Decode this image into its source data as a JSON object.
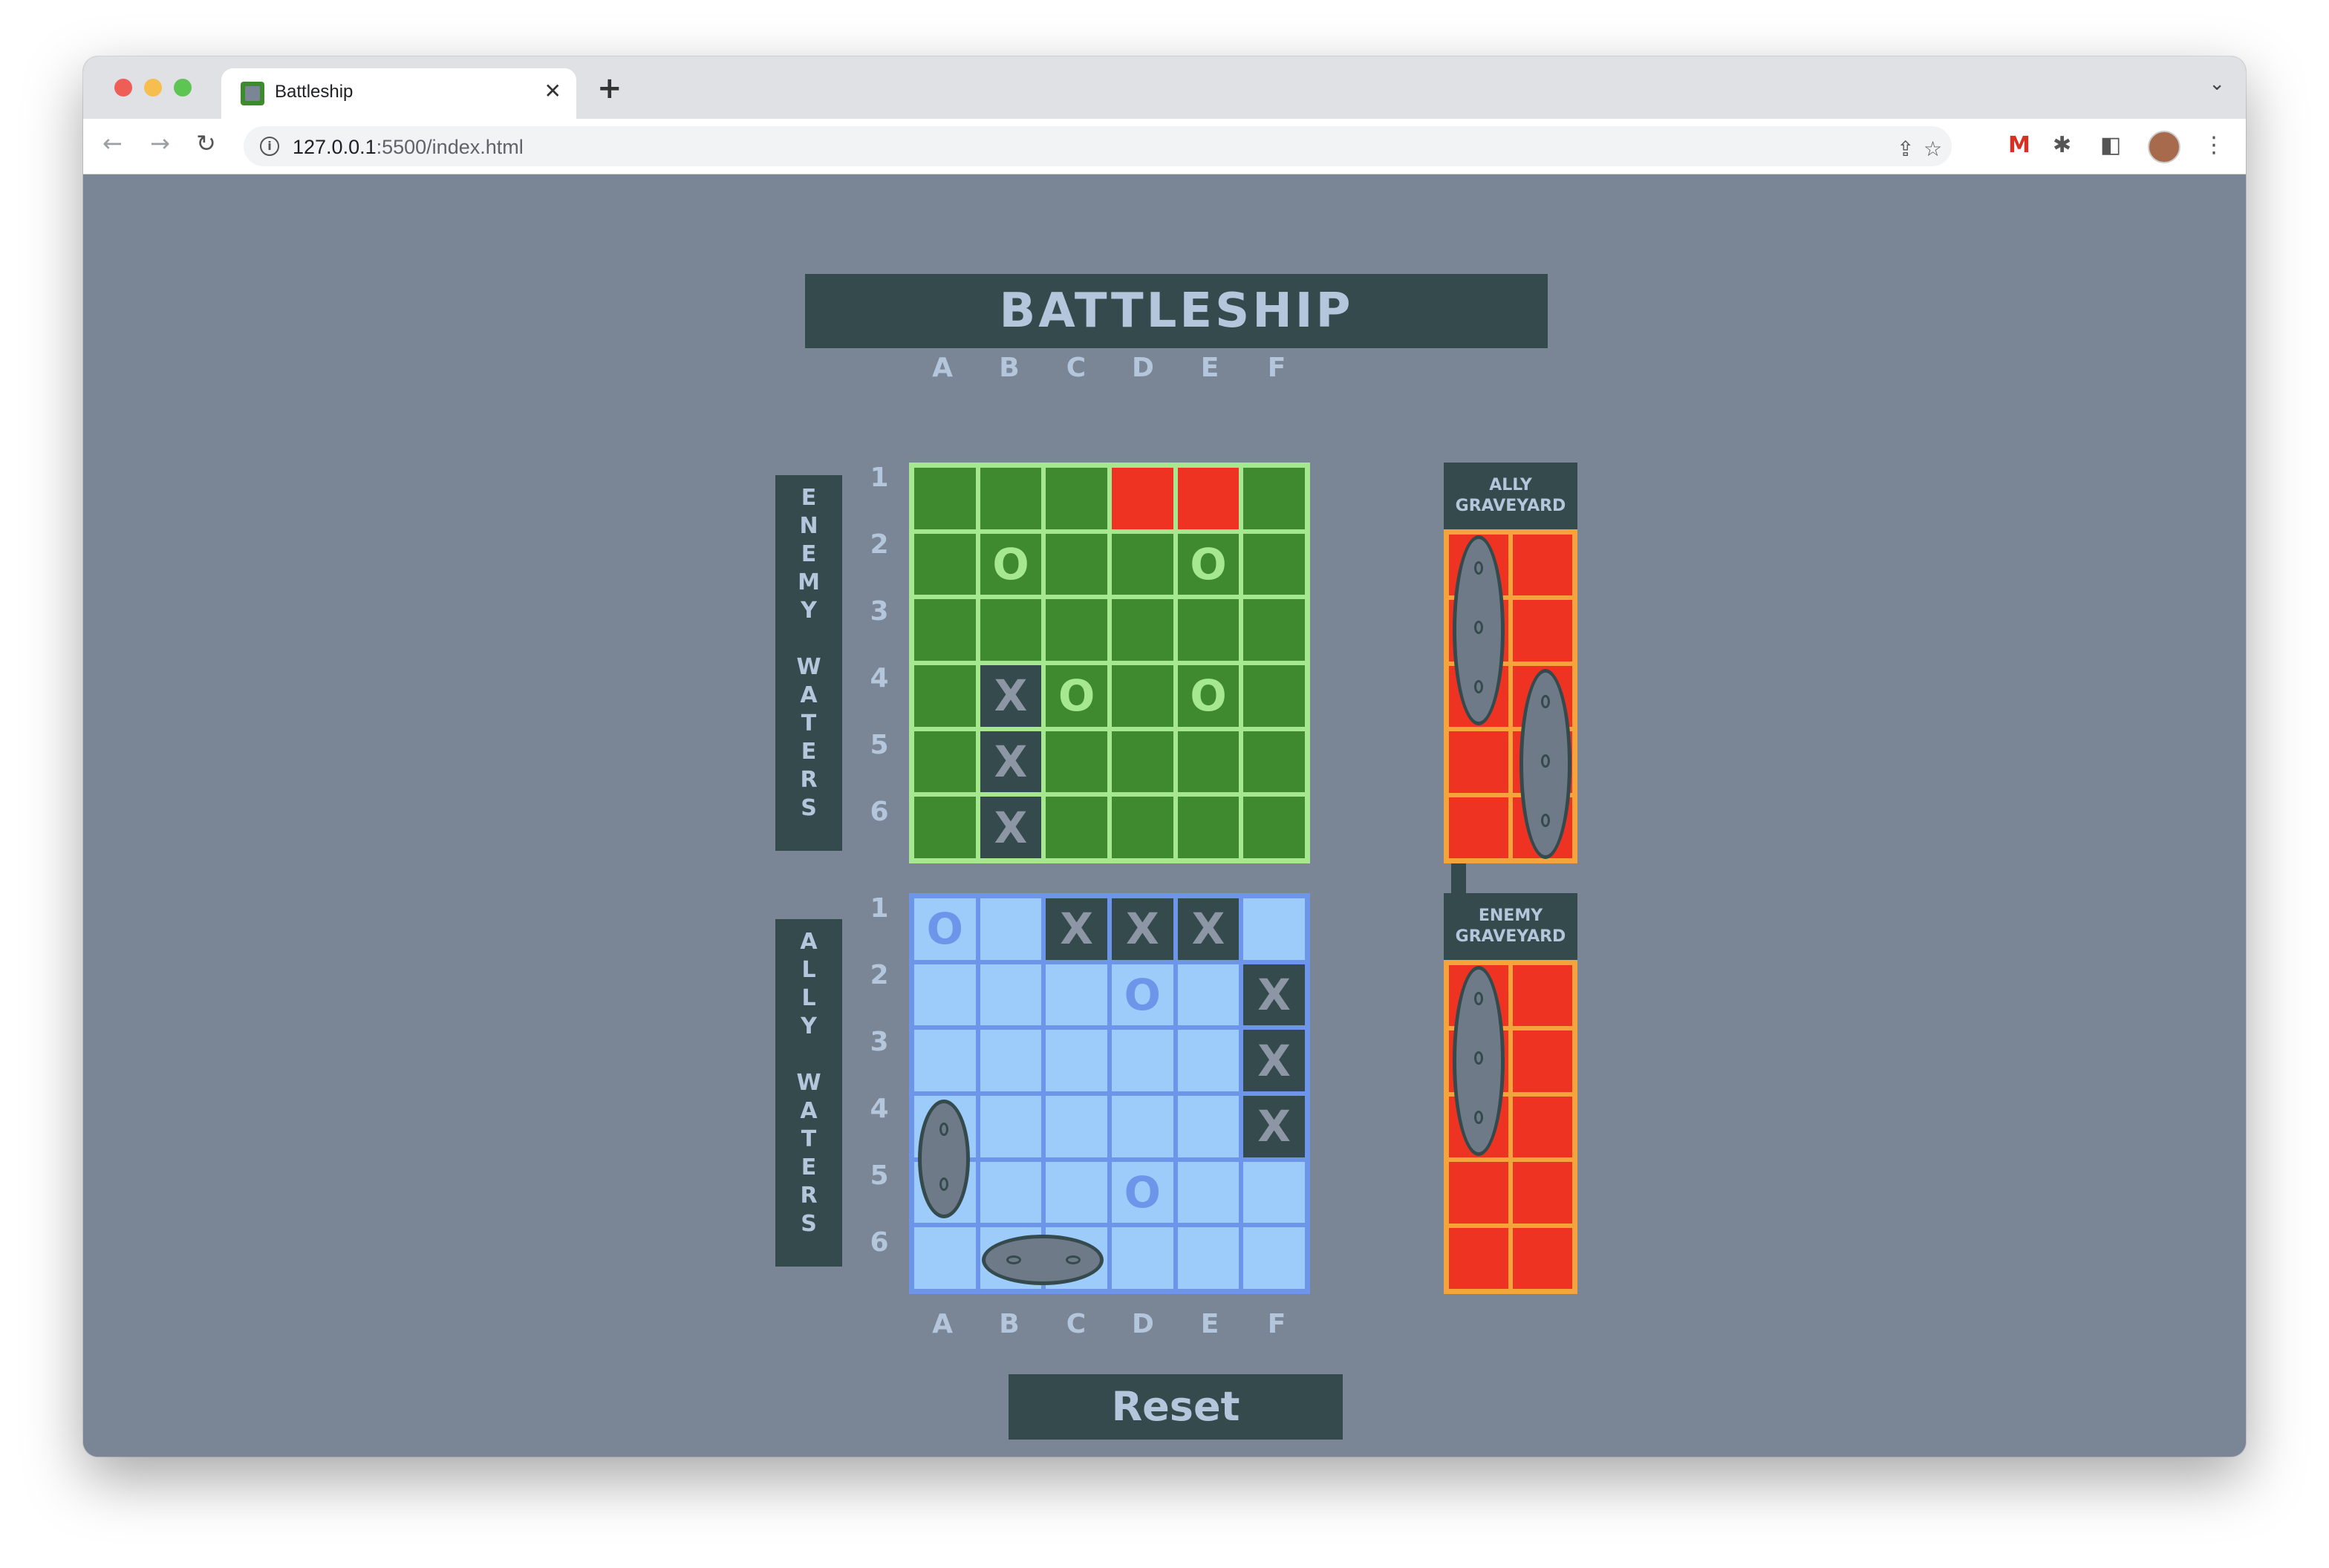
{
  "browser": {
    "tab_title": "Battleship",
    "tab_close": "✕",
    "new_tab": "+",
    "url_host": "127.0.0.1",
    "url_rest": ":5500/index.html"
  },
  "game": {
    "title": "BATTLESHIP",
    "columns": [
      "A",
      "B",
      "C",
      "D",
      "E",
      "F"
    ],
    "rows": [
      "1",
      "2",
      "3",
      "4",
      "5",
      "6"
    ],
    "enemy_label": "ENEMY WATERS",
    "ally_label": "ALLY WATERS",
    "ally_graveyard_line1": "ALLY",
    "ally_graveyard_line2": "GRAVEYARD",
    "enemy_graveyard_line1": "ENEMY",
    "enemy_graveyard_line2": "GRAVEYARD",
    "reset_label": "Reset"
  },
  "enemy_board": [
    [
      "",
      "",
      "",
      "red",
      "red",
      ""
    ],
    [
      "",
      "O",
      "",
      "",
      "O",
      ""
    ],
    [
      "",
      "",
      "",
      "",
      "",
      ""
    ],
    [
      "",
      "X",
      "O",
      "",
      "O",
      ""
    ],
    [
      "",
      "X",
      "",
      "",
      "",
      ""
    ],
    [
      "",
      "X",
      "",
      "",
      "",
      ""
    ]
  ],
  "ally_board": [
    [
      "O",
      "",
      "X",
      "X",
      "X",
      ""
    ],
    [
      "",
      "",
      "",
      "O",
      "",
      "X"
    ],
    [
      "",
      "",
      "",
      "",
      "",
      "X"
    ],
    [
      "",
      "",
      "",
      "",
      "",
      "X"
    ],
    [
      "",
      "",
      "",
      "O",
      "",
      ""
    ],
    [
      "",
      "",
      "",
      "",
      "",
      ""
    ]
  ],
  "ships": {
    "ally_board_vertical": "ship-icon",
    "ally_board_horizontal": "ship-icon",
    "sunk_ally": "ship-icon",
    "sunk_enemy": "ship-icon"
  },
  "colors": {
    "background": "#7a8595",
    "panel": "#344a4c",
    "enemy_water": "#3f8a2e",
    "ally_water": "#9dcbfa",
    "hit": "#ee3322",
    "graveyard_border": "#f4a43a"
  }
}
